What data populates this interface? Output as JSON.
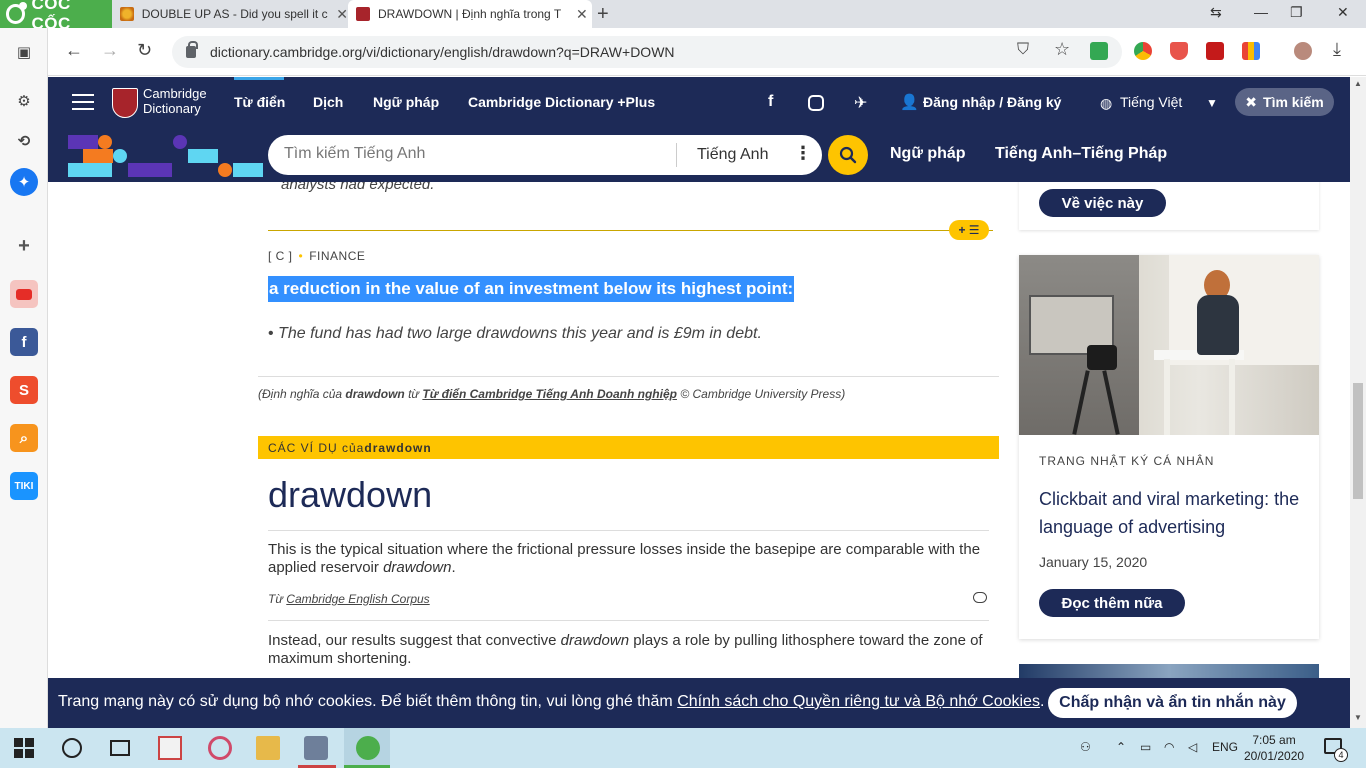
{
  "browser": {
    "brand": "CỐC CỐC",
    "tabs": [
      {
        "title": "DOUBLE UP AS - Did you spell it c",
        "close": "✕"
      },
      {
        "title": "DRAWDOWN | Định nghĩa trong T",
        "close": "✕"
      }
    ],
    "new_tab": "+",
    "url": "dictionary.cambridge.org/vi/dictionary/english/drawdown?q=DRAW+DOWN"
  },
  "header": {
    "logo_line1": "Cambridge",
    "logo_line2": "Dictionary",
    "nav": [
      "Từ điển",
      "Dịch",
      "Ngữ pháp",
      "Cambridge Dictionary +Plus"
    ],
    "login": "Đăng nhập / Đăng ký",
    "language": "Tiếng Việt",
    "search_button": "Tìm kiếm"
  },
  "search": {
    "placeholder": "Tìm kiếm Tiếng Anh",
    "dataset": "Tiếng Anh",
    "links": [
      "Ngữ pháp",
      "Tiếng Anh–Tiếng Pháp"
    ]
  },
  "entry": {
    "prev_example": "analysts had expected.",
    "grammar": "[ C ]",
    "domain": "FINANCE",
    "definition": "a reduction in the value of an investment below its highest point:",
    "example": "The fund has had two large drawdowns this year and is £9m in debt.",
    "source_prefix": "(Định nghĩa của",
    "source_word": "drawdown",
    "source_from": "từ",
    "source_link": "Từ điển Cambridge Tiếng Anh Doanh nghiệp",
    "source_suffix": "© Cambridge University Press)",
    "examples_bar_prefix": "CÁC VÍ DỤ của",
    "examples_bar_word": "drawdown",
    "headword": "drawdown",
    "examples": [
      {
        "before": "This is the typical situation where the frictional pressure losses inside the basepipe are comparable with the applied reservoir ",
        "word": "drawdown",
        "after": "."
      },
      {
        "before": "Instead, our results suggest that convective ",
        "word": "drawdown",
        "after": " plays a role by pulling lithosphere toward the zone of maximum shortening."
      }
    ],
    "from_label": "Từ",
    "from_source": "Cambridge English Corpus"
  },
  "sidebar": {
    "about_button": "Về việc này",
    "kicker": "TRANG NHẬT KÝ CÁ NHÂN",
    "title": "Clickbait and viral marketing: the language of advertising",
    "date": "January 15, 2020",
    "read_more": "Đọc thêm nữa"
  },
  "cookie": {
    "text": "Trang mạng này có sử dụng bộ nhớ cookies. Để biết thêm thông tin, vui lòng ghé thăm ",
    "link": "Chính sách cho Quyền riêng tư và Bộ nhớ Cookies",
    "end": ".",
    "accept": "Chấp nhận và ẩn tin nhắn này"
  },
  "taskbar": {
    "lang": "ENG",
    "time": "7:05 am",
    "date": "20/01/2020",
    "notif_count": "4"
  },
  "colors": {
    "brand_navy": "#1d2a57",
    "accent_yellow": "#fec400",
    "selection_blue": "#3390ff",
    "coccoc_green": "#4cae4c"
  }
}
